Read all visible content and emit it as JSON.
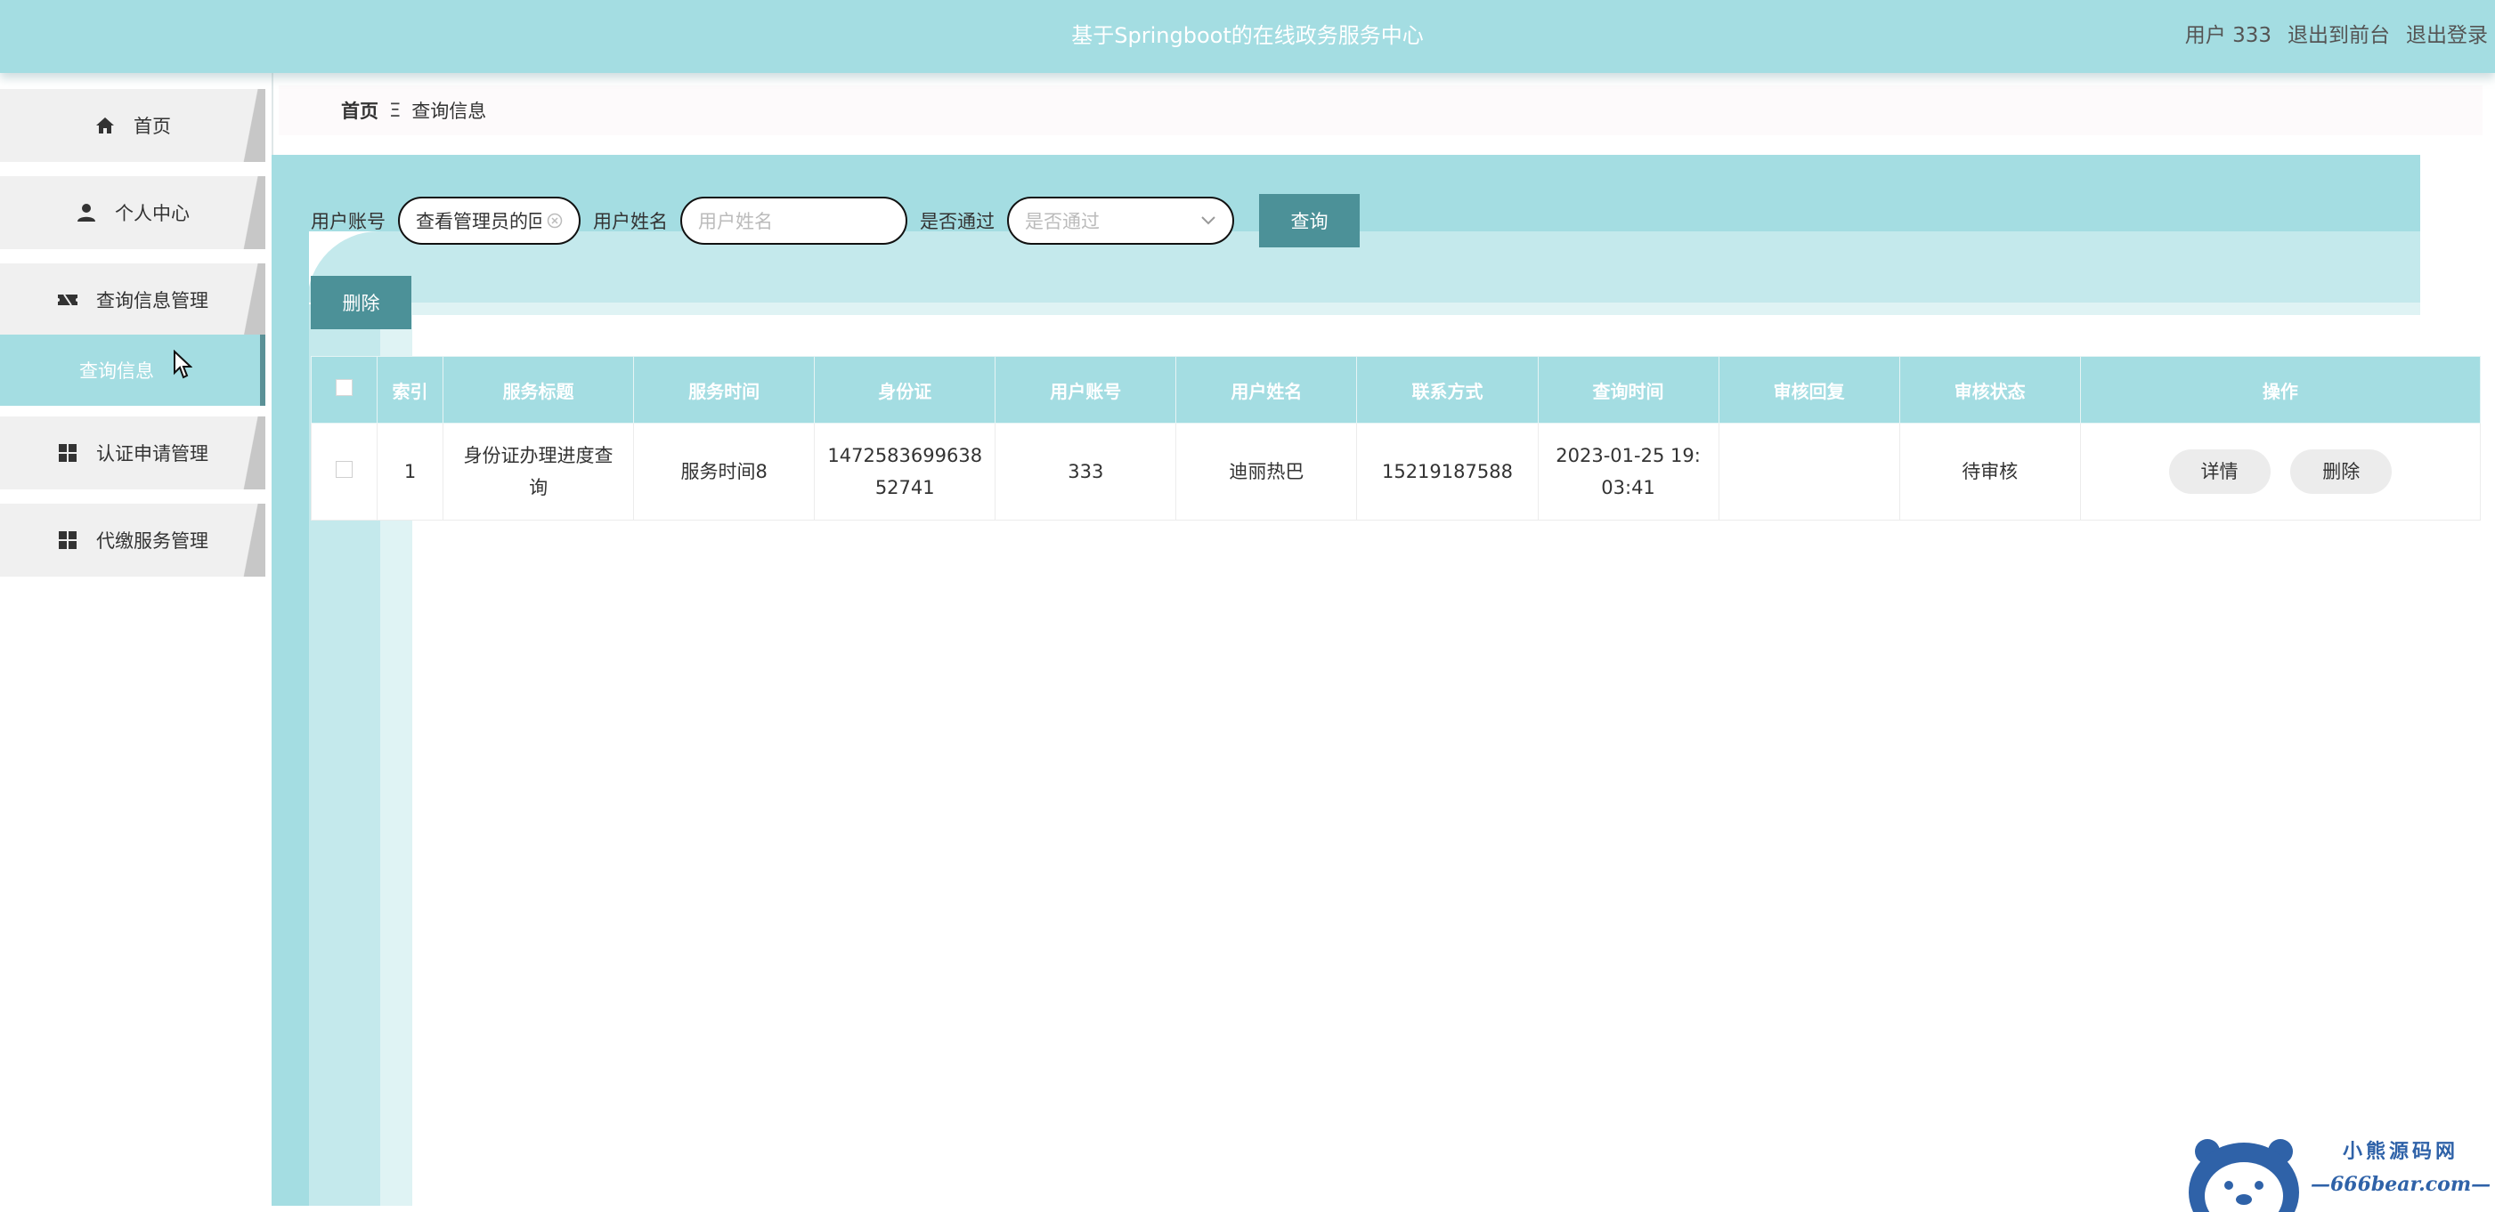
{
  "header": {
    "title": "基于Springboot的在线政务服务中心",
    "user_label": "用户 333",
    "back_to_front": "退出到前台",
    "logout": "退出登录",
    "bg_color": "#a4dde2"
  },
  "sidebar": {
    "items": [
      {
        "label": "首页",
        "icon": "home-icon"
      },
      {
        "label": "个人中心",
        "icon": "user-icon"
      },
      {
        "label": "查询信息管理",
        "icon": "ticket-icon"
      },
      {
        "label": "查询信息",
        "icon": "",
        "active": true
      },
      {
        "label": "认证申请管理",
        "icon": "grid-icon"
      },
      {
        "label": "代缴服务管理",
        "icon": "grid-icon"
      }
    ]
  },
  "breadcrumb": {
    "home": "首页",
    "separator": "Ξ",
    "current": "查询信息"
  },
  "search": {
    "account_label": "用户账号",
    "account_value": "查看管理员的回复",
    "name_label": "用户姓名",
    "name_placeholder": "用户姓名",
    "passed_label": "是否通过",
    "passed_placeholder": "是否通过",
    "query_button": "查询",
    "accent_color": "#4c9198"
  },
  "actions": {
    "delete_button": "删除"
  },
  "table": {
    "columns": [
      "索引",
      "服务标题",
      "服务时间",
      "身份证",
      "用户账号",
      "用户姓名",
      "联系方式",
      "查询时间",
      "审核回复",
      "审核状态",
      "操作"
    ],
    "rows": [
      {
        "index": "1",
        "service_title": "身份证办理进度查询",
        "service_time": "服务时间8",
        "id_card": "147258369963852741",
        "account": "333",
        "name": "迪丽热巴",
        "phone": "15219187588",
        "query_time": "2023-01-25 19:03:41",
        "review_reply": "",
        "review_status": "待审核",
        "detail_button": "详情",
        "delete_button": "删除"
      }
    ]
  },
  "watermark": {
    "line1": "小熊源码网",
    "line2": "—666bear.com—"
  }
}
